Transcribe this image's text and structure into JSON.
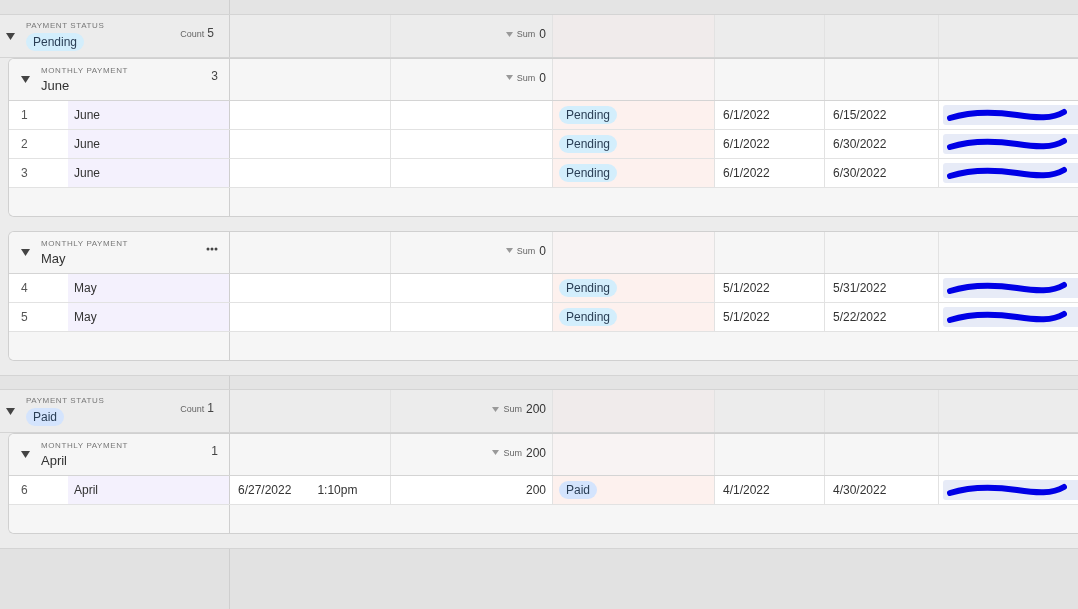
{
  "groups": [
    {
      "field_label": "PAYMENT STATUS",
      "value": "Pending",
      "color": "#d3eefc",
      "count_label": "Count",
      "count": "5",
      "expanded": true,
      "sum_label": "Sum",
      "sum": "0",
      "subgroups": [
        {
          "field_label": "MONTHLY PAYMENT",
          "value": "June",
          "count": "3",
          "expanded": true,
          "sum_label": "Sum",
          "sum": "0",
          "menu_shown": false,
          "rows": [
            {
              "number": "1",
              "month": "June",
              "status": {
                "label": "Pending",
                "color": "#d3eefc"
              },
              "start": "6/1/2022",
              "end": "6/15/2022",
              "linked": {
                "kind": "redacted"
              }
            },
            {
              "number": "2",
              "month": "June",
              "status": {
                "label": "Pending",
                "color": "#d3eefc"
              },
              "start": "6/1/2022",
              "end": "6/30/2022",
              "linked": {
                "kind": "redacted"
              }
            },
            {
              "number": "3",
              "month": "June",
              "status": {
                "label": "Pending",
                "color": "#d3eefc"
              },
              "start": "6/1/2022",
              "end": "6/30/2022",
              "linked": {
                "kind": "redacted"
              }
            }
          ]
        },
        {
          "field_label": "MONTHLY PAYMENT",
          "value": "May",
          "expanded": true,
          "sum_label": "Sum",
          "sum": "0",
          "menu_shown": true,
          "rows": [
            {
              "number": "4",
              "month": "May",
              "status": {
                "label": "Pending",
                "color": "#d3eefc"
              },
              "start": "5/1/2022",
              "end": "5/31/2022",
              "linked": {
                "kind": "redacted"
              }
            },
            {
              "number": "5",
              "month": "May",
              "status": {
                "label": "Pending",
                "color": "#d3eefc"
              },
              "start": "5/1/2022",
              "end": "5/22/2022",
              "linked": {
                "kind": "redacted"
              }
            }
          ]
        }
      ]
    },
    {
      "field_label": "PAYMENT STATUS",
      "value": "Paid",
      "color": "#d4e4fd",
      "count_label": "Count",
      "count": "1",
      "expanded": true,
      "sum_label": "Sum",
      "sum": "200",
      "subgroups": [
        {
          "field_label": "MONTHLY PAYMENT",
          "value": "April",
          "count": "1",
          "expanded": true,
          "sum_label": "Sum",
          "sum": "200",
          "menu_shown": false,
          "rows": [
            {
              "number": "6",
              "month": "April",
              "date": "6/27/2022",
              "time": "1:10pm",
              "amount": "200",
              "status": {
                "label": "Paid",
                "color": "#d4e4fd"
              },
              "start": "4/1/2022",
              "end": "4/30/2022",
              "linked": {
                "kind": "redacted"
              }
            }
          ]
        }
      ]
    }
  ]
}
